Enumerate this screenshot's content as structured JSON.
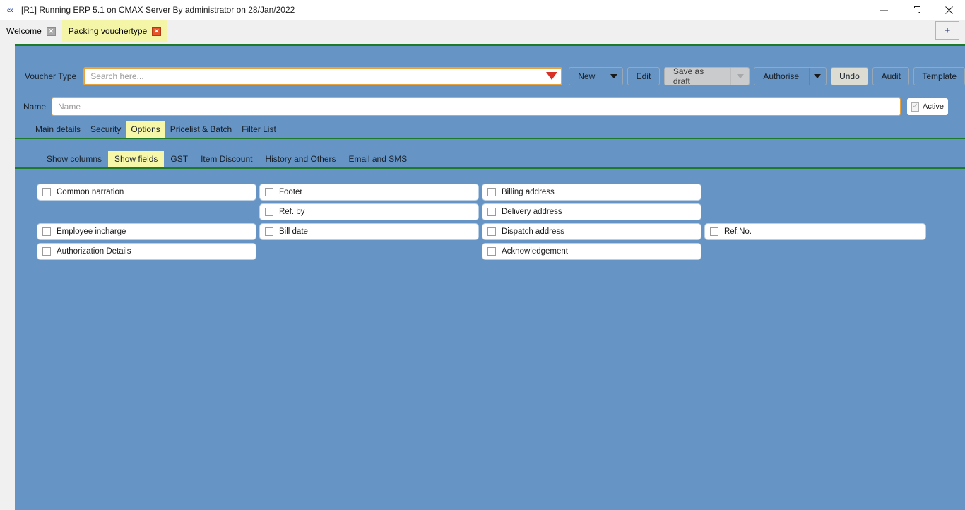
{
  "window": {
    "title": "[R1] Running ERP 5.1 on CMAX Server By administrator on 28/Jan/2022",
    "icon_label": "cx",
    "minimize_label": "—",
    "restore_label": "❐",
    "close_label": "✕"
  },
  "tabstrip": {
    "tabs": [
      {
        "label": "Welcome",
        "close_label": "✕",
        "active": false
      },
      {
        "label": "Packing vouchertype",
        "close_label": "✕",
        "active": true
      }
    ],
    "new_tab_label": "+"
  },
  "form": {
    "voucher_type_label": "Voucher Type",
    "search_placeholder": "Search here...",
    "search_value": "",
    "name_label": "Name",
    "name_placeholder": "Name",
    "name_value": "",
    "active_label": "Active",
    "active_checked": true
  },
  "toolbar": {
    "new_label": "New",
    "edit_label": "Edit",
    "save_as_draft_label": "Save as draft",
    "authorise_label": "Authorise",
    "undo_label": "Undo",
    "audit_label": "Audit",
    "template_label": "Template"
  },
  "main_tabs": [
    {
      "label": "Main details",
      "active": false
    },
    {
      "label": "Security",
      "active": false
    },
    {
      "label": "Options",
      "active": true
    },
    {
      "label": "Pricelist & Batch",
      "active": false
    },
    {
      "label": "Filter List",
      "active": false
    }
  ],
  "sub_tabs": [
    {
      "label": "Show columns",
      "active": false
    },
    {
      "label": "Show fields",
      "active": true
    },
    {
      "label": "GST",
      "active": false
    },
    {
      "label": "Item Discount",
      "active": false
    },
    {
      "label": "History and Others",
      "active": false
    },
    {
      "label": "Email and SMS",
      "active": false
    }
  ],
  "fields_grid": {
    "rows": [
      [
        {
          "label": "Common narration",
          "checked": false,
          "present": true
        },
        {
          "label": "Footer",
          "checked": false,
          "present": true
        },
        {
          "label": "Billing address",
          "checked": false,
          "present": true
        },
        {
          "label": "",
          "checked": false,
          "present": false
        }
      ],
      [
        {
          "label": "",
          "checked": false,
          "present": false
        },
        {
          "label": "Ref. by",
          "checked": false,
          "present": true
        },
        {
          "label": "Delivery address",
          "checked": false,
          "present": true
        },
        {
          "label": "",
          "checked": false,
          "present": false
        }
      ],
      [
        {
          "label": "Employee incharge",
          "checked": false,
          "present": true
        },
        {
          "label": "Bill date",
          "checked": false,
          "present": true
        },
        {
          "label": "Dispatch address",
          "checked": false,
          "present": true
        },
        {
          "label": "Ref.No.",
          "checked": false,
          "present": true
        }
      ],
      [
        {
          "label": "Authorization Details",
          "checked": false,
          "present": true
        },
        {
          "label": "",
          "checked": false,
          "present": false
        },
        {
          "label": "Acknowledgement",
          "checked": false,
          "present": true
        },
        {
          "label": "",
          "checked": false,
          "present": false
        }
      ]
    ]
  },
  "colors": {
    "page_background": "#6694c4",
    "active_tab_highlight": "#f5f5a8",
    "divider_green": "#1d7a28",
    "focus_border": "#e8a33d",
    "dropdown_red": "#d93025",
    "tab_close_hot": "#e8542a"
  }
}
